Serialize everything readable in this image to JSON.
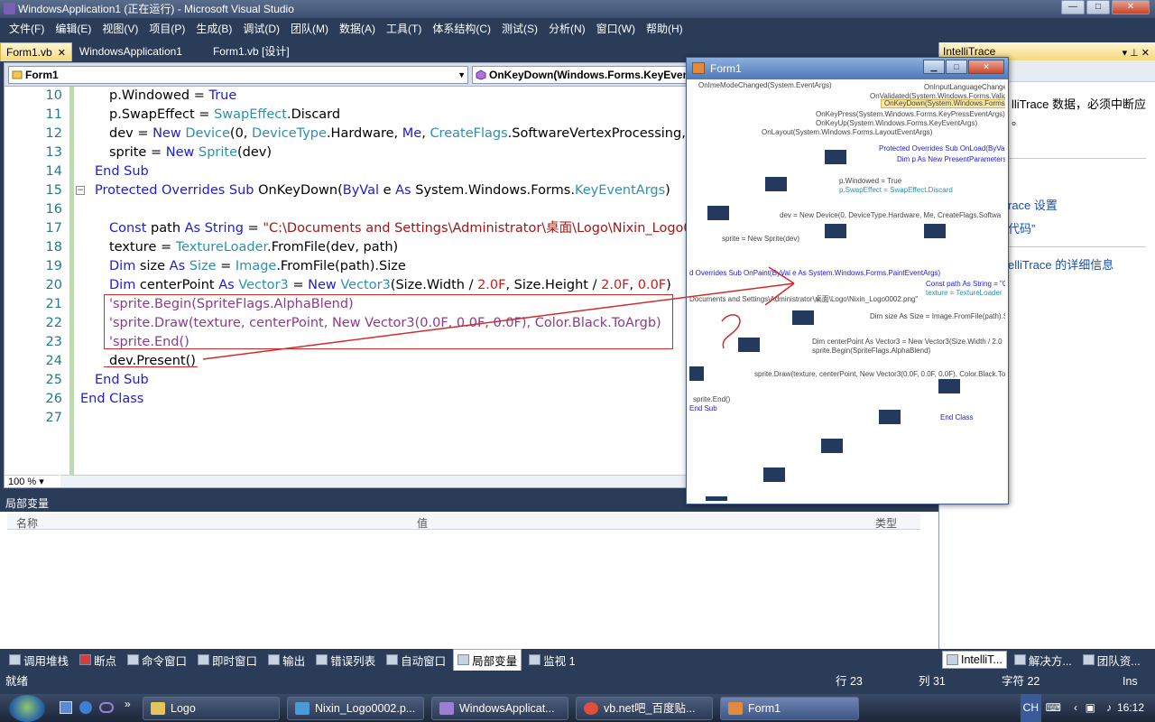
{
  "window": {
    "title": "WindowsApplication1 (正在运行) - Microsoft Visual Studio"
  },
  "menu": [
    "文件(F)",
    "编辑(E)",
    "视图(V)",
    "项目(P)",
    "生成(B)",
    "调试(D)",
    "团队(M)",
    "数据(A)",
    "工具(T)",
    "体系结构(C)",
    "测试(S)",
    "分析(N)",
    "窗口(W)",
    "帮助(H)"
  ],
  "doc_tabs": [
    {
      "label": "Form1.vb",
      "active": true
    },
    {
      "label": "WindowsApplication1",
      "active": false
    },
    {
      "label": "Form1.vb [设计]",
      "active": false
    }
  ],
  "nav": {
    "class_combo": "Form1",
    "method_combo": "OnKeyDown(Windows.Forms.KeyEventArgs)"
  },
  "code": {
    "zoom": "100 %",
    "lines": [
      {
        "n": "10",
        "text": "        p.Windowed = True"
      },
      {
        "n": "11",
        "text": "        p.SwapEffect = SwapEffect.Discard"
      },
      {
        "n": "12",
        "text": "        dev = New Device(0, DeviceType.Hardware, Me, CreateFlags.SoftwareVertexProcessing, p)"
      },
      {
        "n": "13",
        "text": "        sprite = New Sprite(dev)"
      },
      {
        "n": "14",
        "text": "    End Sub"
      },
      {
        "n": "15",
        "text": "    Protected Overrides Sub OnKeyDown(ByVal e As System.Windows.Forms.KeyEventArgs)"
      },
      {
        "n": "16",
        "text": ""
      },
      {
        "n": "17",
        "text": "        Const path As String = \"C:\\Documents and Settings\\Administrator\\桌面\\Logo\\Nixin_Logo0002.png\""
      },
      {
        "n": "18",
        "text": "        texture = TextureLoader.FromFile(dev, path)"
      },
      {
        "n": "19",
        "text": "        Dim size As Size = Image.FromFile(path).Size"
      },
      {
        "n": "20",
        "text": "        Dim centerPoint As Vector3 = New Vector3(Size.Width / 2.0F, Size.Height / 2.0F, 0.0F)"
      },
      {
        "n": "21",
        "text": "        'sprite.Begin(SpriteFlags.AlphaBlend)"
      },
      {
        "n": "22",
        "text": "        'sprite.Draw(texture, centerPoint, New Vector3(0.0F, 0.0F, 0.0F), Color.Black.ToArgb)"
      },
      {
        "n": "23",
        "text": "        'sprite.End()"
      },
      {
        "n": "24",
        "text": "        dev.Present()"
      },
      {
        "n": "25",
        "text": "    End Sub"
      },
      {
        "n": "26",
        "text": "End Class"
      },
      {
        "n": "27",
        "text": ""
      }
    ]
  },
  "annotation": {
    "mark": "?"
  },
  "intellitrace": {
    "title": "IntelliTrace",
    "line1": "lliTrace 数据，必须中断应",
    "line2": "。",
    "link1": "race 设置",
    "link2": "代码”",
    "link3": "elliTrace 的详细信息"
  },
  "locals": {
    "title": "局部变量",
    "columns": [
      "名称",
      "值",
      "类型"
    ]
  },
  "bottom_tabs": [
    "调用堆栈",
    "断点",
    "命令窗口",
    "即时窗口",
    "输出",
    "错误列表",
    "自动窗口",
    "局部变量",
    "监视 1"
  ],
  "bottom_tabs_active": "局部变量",
  "right_tabs": [
    "IntelliT...",
    "解决方...",
    "团队资..."
  ],
  "status": {
    "ready": "就绪",
    "row": "行 23",
    "col": "列 31",
    "ch": "字符 22",
    "mode": "Ins"
  },
  "taskbar": {
    "items": [
      {
        "label": "Logo",
        "active": false
      },
      {
        "label": "Nixin_Logo0002.p...",
        "active": false
      },
      {
        "label": "WindowsApplicat...",
        "active": false
      },
      {
        "label": "vb.net吧_百度贴...",
        "active": false
      },
      {
        "label": "Form1",
        "active": true
      }
    ],
    "ime": "CH",
    "clock": "16:12"
  },
  "form1": {
    "title": "Form1",
    "garbage_lines": [
      "OnImeModeChanged(System.EventArgs)",
      "OnInputLanguageChanged",
      "OnValidated(System.Windows.Forms.Validated",
      "OnKeyDown(System.Windows.Forms.KeyEventArgs)",
      "OnKeyPress(System.Windows.Forms.KeyPressEventArgs)",
      "OnKeyUp(System.Windows.Forms.KeyEventArgs)",
      "OnLayout(System.Windows.Forms.LayoutEventArgs)",
      "Protected Overrides Sub OnLoad(ByVal e",
      "Dim p As New PresentParameters",
      "p.Windowed = True",
      "p.SwapEffect = SwapEffect.Discard",
      "dev = New Device(0, DeviceType.Hardware, Me, CreateFlags.Softwa",
      "sprite = New Sprite(dev)",
      "d Overrides Sub OnPaint(ByVal e As System.Windows.Forms.PaintEventArgs)",
      "Const path As String = \"C",
      "texture = TextureLoader",
      "Documents and Settings\\Administrator\\桌面\\Logo\\Nixin_Logo0002.png\"",
      "Dim size As Size = Image.FromFile(path).Si",
      "Dim centerPoint As Vector3 = New Vector3(Size.Width / 2.0",
      "sprite.Begin(SpriteFlags.AlphaBlend)",
      "sprite.Draw(texture, centerPoint, New Vector3(0.0F, 0.0F, 0.0F), Color.Black.To",
      "sprite.End()",
      "End Sub",
      "End Class"
    ]
  }
}
